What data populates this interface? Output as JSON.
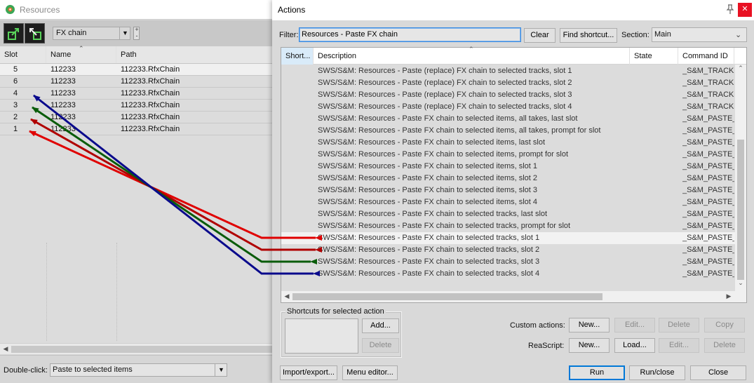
{
  "resources": {
    "title": "Resources",
    "type_select": "FX chain",
    "columns": [
      "Slot",
      "Name",
      "Path"
    ],
    "rows": [
      {
        "slot": "5",
        "name": "112233",
        "path": "112233.RfxChain"
      },
      {
        "slot": "6",
        "name": "112233",
        "path": "112233.RfxChain"
      },
      {
        "slot": "4",
        "name": "112233",
        "path": "112233.RfxChain"
      },
      {
        "slot": "3",
        "name": "112233",
        "path": "112233.RfxChain"
      },
      {
        "slot": "2",
        "name": "112233",
        "path": "112233.RfxChain"
      },
      {
        "slot": "1",
        "name": "112233",
        "path": "112233.RfxChain"
      }
    ],
    "doubleclick_label": "Double-click:",
    "doubleclick_value": "Paste to selected items"
  },
  "actions": {
    "title": "Actions",
    "filter_label": "Filter:",
    "filter_value": "Resources - Paste FX chain",
    "clear_label": "Clear",
    "find_shortcut_label": "Find shortcut...",
    "section_label": "Section:",
    "section_value": "Main",
    "columns": [
      "Short...",
      "Description",
      "State",
      "Command ID"
    ],
    "rows": [
      {
        "desc": "SWS/S&M: Resources - Paste (replace) FX chain to selected tracks, slot 1",
        "cmd": "_S&M_TRACKF"
      },
      {
        "desc": "SWS/S&M: Resources - Paste (replace) FX chain to selected tracks, slot 2",
        "cmd": "_S&M_TRACKF"
      },
      {
        "desc": "SWS/S&M: Resources - Paste (replace) FX chain to selected tracks, slot 3",
        "cmd": "_S&M_TRACKF"
      },
      {
        "desc": "SWS/S&M: Resources - Paste (replace) FX chain to selected tracks, slot 4",
        "cmd": "_S&M_TRACKF"
      },
      {
        "desc": "SWS/S&M: Resources - Paste FX chain to selected items, all takes, last slot",
        "cmd": "_S&M_PASTE_"
      },
      {
        "desc": "SWS/S&M: Resources - Paste FX chain to selected items, all takes, prompt for slot",
        "cmd": "_S&M_PASTE_"
      },
      {
        "desc": "SWS/S&M: Resources - Paste FX chain to selected items, last slot",
        "cmd": "_S&M_PASTE_"
      },
      {
        "desc": "SWS/S&M: Resources - Paste FX chain to selected items, prompt for slot",
        "cmd": "_S&M_PASTE_"
      },
      {
        "desc": "SWS/S&M: Resources - Paste FX chain to selected items, slot 1",
        "cmd": "_S&M_PASTE_"
      },
      {
        "desc": "SWS/S&M: Resources - Paste FX chain to selected items, slot 2",
        "cmd": "_S&M_PASTE_"
      },
      {
        "desc": "SWS/S&M: Resources - Paste FX chain to selected items, slot 3",
        "cmd": "_S&M_PASTE_"
      },
      {
        "desc": "SWS/S&M: Resources - Paste FX chain to selected items, slot 4",
        "cmd": "_S&M_PASTE_"
      },
      {
        "desc": "SWS/S&M: Resources - Paste FX chain to selected tracks, last slot",
        "cmd": "_S&M_PASTE_"
      },
      {
        "desc": "SWS/S&M: Resources - Paste FX chain to selected tracks, prompt for slot",
        "cmd": "_S&M_PASTE_"
      },
      {
        "desc": "SWS/S&M: Resources - Paste FX chain to selected tracks, slot 1",
        "cmd": "_S&M_PASTE_"
      },
      {
        "desc": "SWS/S&M: Resources - Paste FX chain to selected tracks, slot 2",
        "cmd": "_S&M_PASTE_"
      },
      {
        "desc": "SWS/S&M: Resources - Paste FX chain to selected tracks, slot 3",
        "cmd": "_S&M_PASTE_"
      },
      {
        "desc": "SWS/S&M: Resources - Paste FX chain to selected tracks, slot 4",
        "cmd": "_S&M_PASTE_"
      }
    ],
    "shortcuts_group": "Shortcuts for selected action",
    "add_label": "Add...",
    "delete_label": "Delete",
    "custom_actions_label": "Custom actions:",
    "reascript_label": "ReaScript:",
    "new_label": "New...",
    "edit_label": "Edit...",
    "copy_label": "Copy",
    "load_label": "Load...",
    "import_export_label": "Import/export...",
    "menu_editor_label": "Menu editor...",
    "run_label": "Run",
    "run_close_label": "Run/close",
    "close_label": "Close"
  },
  "colors": {
    "arrow_slot1": "#e00000",
    "arrow_slot2": "#b00000",
    "arrow_slot3": "#0a5c0a",
    "arrow_slot4": "#0a0a8c"
  }
}
